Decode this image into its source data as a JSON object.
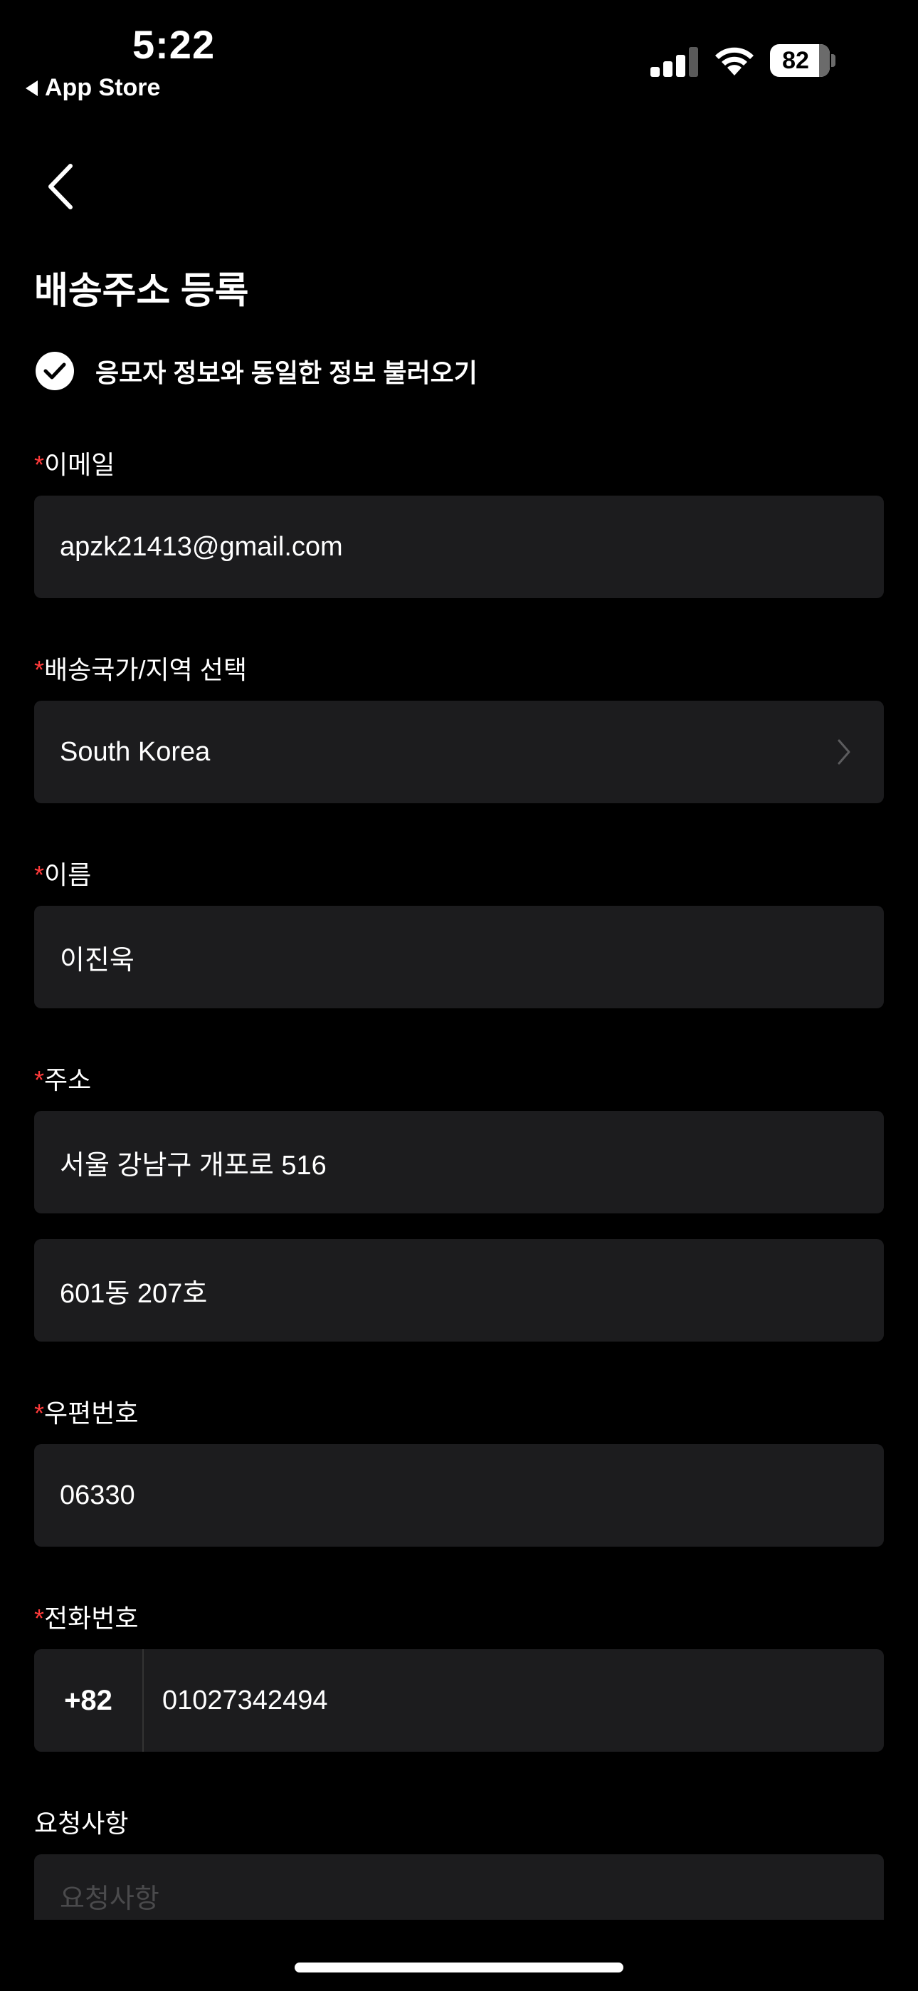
{
  "status_bar": {
    "time": "5:22",
    "back_app": "App Store",
    "battery": "82"
  },
  "page": {
    "title": "배송주소 등록",
    "same_info_label": "응모자 정보와 동일한 정보 불러오기"
  },
  "form": {
    "required_mark": "*",
    "email": {
      "label": "이메일",
      "value": "apzk21413@gmail.com"
    },
    "country": {
      "label": "배송국가/지역 선택",
      "value": "South Korea"
    },
    "name": {
      "label": "이름",
      "value": "이진욱"
    },
    "address": {
      "label": "주소",
      "line1": "서울 강남구 개포로 516",
      "line2": "601동 207호"
    },
    "postal": {
      "label": "우편번호",
      "value": "06330"
    },
    "phone": {
      "label": "전화번호",
      "code": "+82",
      "value": "01027342494"
    },
    "request": {
      "label": "요청사항",
      "placeholder": "요청사항"
    }
  },
  "colors": {
    "background": "#000000",
    "field_bg": "#1c1c1e",
    "required": "#ff3b3b",
    "placeholder": "#4a4a4c"
  },
  "icons": {
    "nav_back": "chevron-left-icon",
    "check": "checkmark-circle-icon",
    "country_select": "chevron-right-icon"
  }
}
